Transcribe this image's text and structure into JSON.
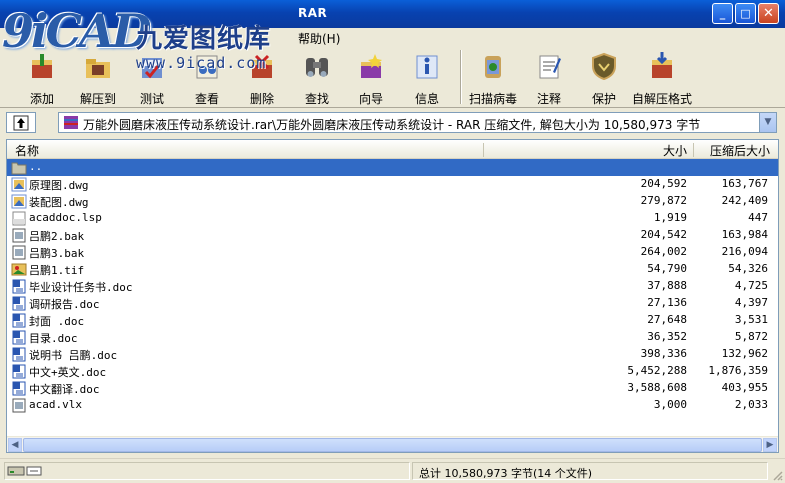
{
  "window": {
    "title_fragment": "RAR",
    "minimize": "_",
    "maximize": "□",
    "close": "✕"
  },
  "logo": {
    "mark": "9iCAD",
    "cn_text": "九爱图纸库",
    "url": "www.9icad.com"
  },
  "menu": {
    "help": "帮助(H)"
  },
  "toolbar": {
    "add": "添加",
    "extract_to": "解压到",
    "test": "测试",
    "view": "查看",
    "delete": "删除",
    "find": "查找",
    "wizard": "向导",
    "info": "信息",
    "scan": "扫描病毒",
    "comment": "注释",
    "protect": "保护",
    "sfx": "自解压格式"
  },
  "address": {
    "path": "万能外圆磨床液压传动系统设计.rar\\万能外圆磨床液压传动系统设计 - RAR 压缩文件, 解包大小为 10,580,973 字节"
  },
  "columns": {
    "name": "名称",
    "size": "大小",
    "packed": "压缩后大小"
  },
  "files": [
    {
      "name": "..",
      "size": "",
      "packed": "",
      "icon": "folder-up-icon"
    },
    {
      "name": "原理图.dwg",
      "size": "204,592",
      "packed": "163,767",
      "icon": "dwg-file-icon"
    },
    {
      "name": "装配图.dwg",
      "size": "279,872",
      "packed": "242,409",
      "icon": "dwg-file-icon"
    },
    {
      "name": "acaddoc.lsp",
      "size": "1,919",
      "packed": "447",
      "icon": "lsp-file-icon"
    },
    {
      "name": "吕鹏2.bak",
      "size": "204,542",
      "packed": "163,984",
      "icon": "bak-file-icon"
    },
    {
      "name": "吕鹏3.bak",
      "size": "264,002",
      "packed": "216,094",
      "icon": "bak-file-icon"
    },
    {
      "name": "吕鹏1.tif",
      "size": "54,790",
      "packed": "54,326",
      "icon": "tif-file-icon"
    },
    {
      "name": "毕业设计任务书.doc",
      "size": "37,888",
      "packed": "4,725",
      "icon": "word-doc-icon"
    },
    {
      "name": "调研报告.doc",
      "size": "27,136",
      "packed": "4,397",
      "icon": "word-doc-icon"
    },
    {
      "name": "封面 .doc",
      "size": "27,648",
      "packed": "3,531",
      "icon": "word-doc-icon"
    },
    {
      "name": "目录.doc",
      "size": "36,352",
      "packed": "5,872",
      "icon": "word-doc-icon"
    },
    {
      "name": "说明书  吕鹏.doc",
      "size": "398,336",
      "packed": "132,962",
      "icon": "word-doc-icon"
    },
    {
      "name": "中文+英文.doc",
      "size": "5,452,288",
      "packed": "1,876,359",
      "icon": "word-doc-icon"
    },
    {
      "name": "中文翻译.doc",
      "size": "3,588,608",
      "packed": "403,955",
      "icon": "word-doc-icon"
    },
    {
      "name": "acad.vlx",
      "size": "3,000",
      "packed": "2,033",
      "icon": "vlx-file-icon"
    }
  ],
  "status": {
    "total": "总计 10,580,973 字节(14 个文件)"
  },
  "colors": {
    "titlebar": "#0a4fc4",
    "selection": "#316ac5",
    "window_bg": "#ece9d8"
  }
}
